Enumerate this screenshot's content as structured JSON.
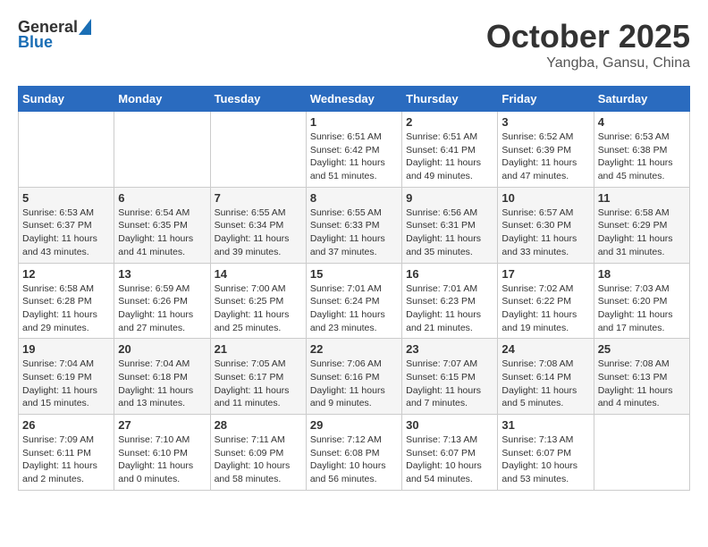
{
  "header": {
    "logo_general": "General",
    "logo_blue": "Blue",
    "month": "October 2025",
    "location": "Yangba, Gansu, China"
  },
  "weekdays": [
    "Sunday",
    "Monday",
    "Tuesday",
    "Wednesday",
    "Thursday",
    "Friday",
    "Saturday"
  ],
  "weeks": [
    [
      {
        "day": "",
        "info": ""
      },
      {
        "day": "",
        "info": ""
      },
      {
        "day": "",
        "info": ""
      },
      {
        "day": "1",
        "info": "Sunrise: 6:51 AM\nSunset: 6:42 PM\nDaylight: 11 hours\nand 51 minutes."
      },
      {
        "day": "2",
        "info": "Sunrise: 6:51 AM\nSunset: 6:41 PM\nDaylight: 11 hours\nand 49 minutes."
      },
      {
        "day": "3",
        "info": "Sunrise: 6:52 AM\nSunset: 6:39 PM\nDaylight: 11 hours\nand 47 minutes."
      },
      {
        "day": "4",
        "info": "Sunrise: 6:53 AM\nSunset: 6:38 PM\nDaylight: 11 hours\nand 45 minutes."
      }
    ],
    [
      {
        "day": "5",
        "info": "Sunrise: 6:53 AM\nSunset: 6:37 PM\nDaylight: 11 hours\nand 43 minutes."
      },
      {
        "day": "6",
        "info": "Sunrise: 6:54 AM\nSunset: 6:35 PM\nDaylight: 11 hours\nand 41 minutes."
      },
      {
        "day": "7",
        "info": "Sunrise: 6:55 AM\nSunset: 6:34 PM\nDaylight: 11 hours\nand 39 minutes."
      },
      {
        "day": "8",
        "info": "Sunrise: 6:55 AM\nSunset: 6:33 PM\nDaylight: 11 hours\nand 37 minutes."
      },
      {
        "day": "9",
        "info": "Sunrise: 6:56 AM\nSunset: 6:31 PM\nDaylight: 11 hours\nand 35 minutes."
      },
      {
        "day": "10",
        "info": "Sunrise: 6:57 AM\nSunset: 6:30 PM\nDaylight: 11 hours\nand 33 minutes."
      },
      {
        "day": "11",
        "info": "Sunrise: 6:58 AM\nSunset: 6:29 PM\nDaylight: 11 hours\nand 31 minutes."
      }
    ],
    [
      {
        "day": "12",
        "info": "Sunrise: 6:58 AM\nSunset: 6:28 PM\nDaylight: 11 hours\nand 29 minutes."
      },
      {
        "day": "13",
        "info": "Sunrise: 6:59 AM\nSunset: 6:26 PM\nDaylight: 11 hours\nand 27 minutes."
      },
      {
        "day": "14",
        "info": "Sunrise: 7:00 AM\nSunset: 6:25 PM\nDaylight: 11 hours\nand 25 minutes."
      },
      {
        "day": "15",
        "info": "Sunrise: 7:01 AM\nSunset: 6:24 PM\nDaylight: 11 hours\nand 23 minutes."
      },
      {
        "day": "16",
        "info": "Sunrise: 7:01 AM\nSunset: 6:23 PM\nDaylight: 11 hours\nand 21 minutes."
      },
      {
        "day": "17",
        "info": "Sunrise: 7:02 AM\nSunset: 6:22 PM\nDaylight: 11 hours\nand 19 minutes."
      },
      {
        "day": "18",
        "info": "Sunrise: 7:03 AM\nSunset: 6:20 PM\nDaylight: 11 hours\nand 17 minutes."
      }
    ],
    [
      {
        "day": "19",
        "info": "Sunrise: 7:04 AM\nSunset: 6:19 PM\nDaylight: 11 hours\nand 15 minutes."
      },
      {
        "day": "20",
        "info": "Sunrise: 7:04 AM\nSunset: 6:18 PM\nDaylight: 11 hours\nand 13 minutes."
      },
      {
        "day": "21",
        "info": "Sunrise: 7:05 AM\nSunset: 6:17 PM\nDaylight: 11 hours\nand 11 minutes."
      },
      {
        "day": "22",
        "info": "Sunrise: 7:06 AM\nSunset: 6:16 PM\nDaylight: 11 hours\nand 9 minutes."
      },
      {
        "day": "23",
        "info": "Sunrise: 7:07 AM\nSunset: 6:15 PM\nDaylight: 11 hours\nand 7 minutes."
      },
      {
        "day": "24",
        "info": "Sunrise: 7:08 AM\nSunset: 6:14 PM\nDaylight: 11 hours\nand 5 minutes."
      },
      {
        "day": "25",
        "info": "Sunrise: 7:08 AM\nSunset: 6:13 PM\nDaylight: 11 hours\nand 4 minutes."
      }
    ],
    [
      {
        "day": "26",
        "info": "Sunrise: 7:09 AM\nSunset: 6:11 PM\nDaylight: 11 hours\nand 2 minutes."
      },
      {
        "day": "27",
        "info": "Sunrise: 7:10 AM\nSunset: 6:10 PM\nDaylight: 11 hours\nand 0 minutes."
      },
      {
        "day": "28",
        "info": "Sunrise: 7:11 AM\nSunset: 6:09 PM\nDaylight: 10 hours\nand 58 minutes."
      },
      {
        "day": "29",
        "info": "Sunrise: 7:12 AM\nSunset: 6:08 PM\nDaylight: 10 hours\nand 56 minutes."
      },
      {
        "day": "30",
        "info": "Sunrise: 7:13 AM\nSunset: 6:07 PM\nDaylight: 10 hours\nand 54 minutes."
      },
      {
        "day": "31",
        "info": "Sunrise: 7:13 AM\nSunset: 6:07 PM\nDaylight: 10 hours\nand 53 minutes."
      },
      {
        "day": "",
        "info": ""
      }
    ]
  ]
}
